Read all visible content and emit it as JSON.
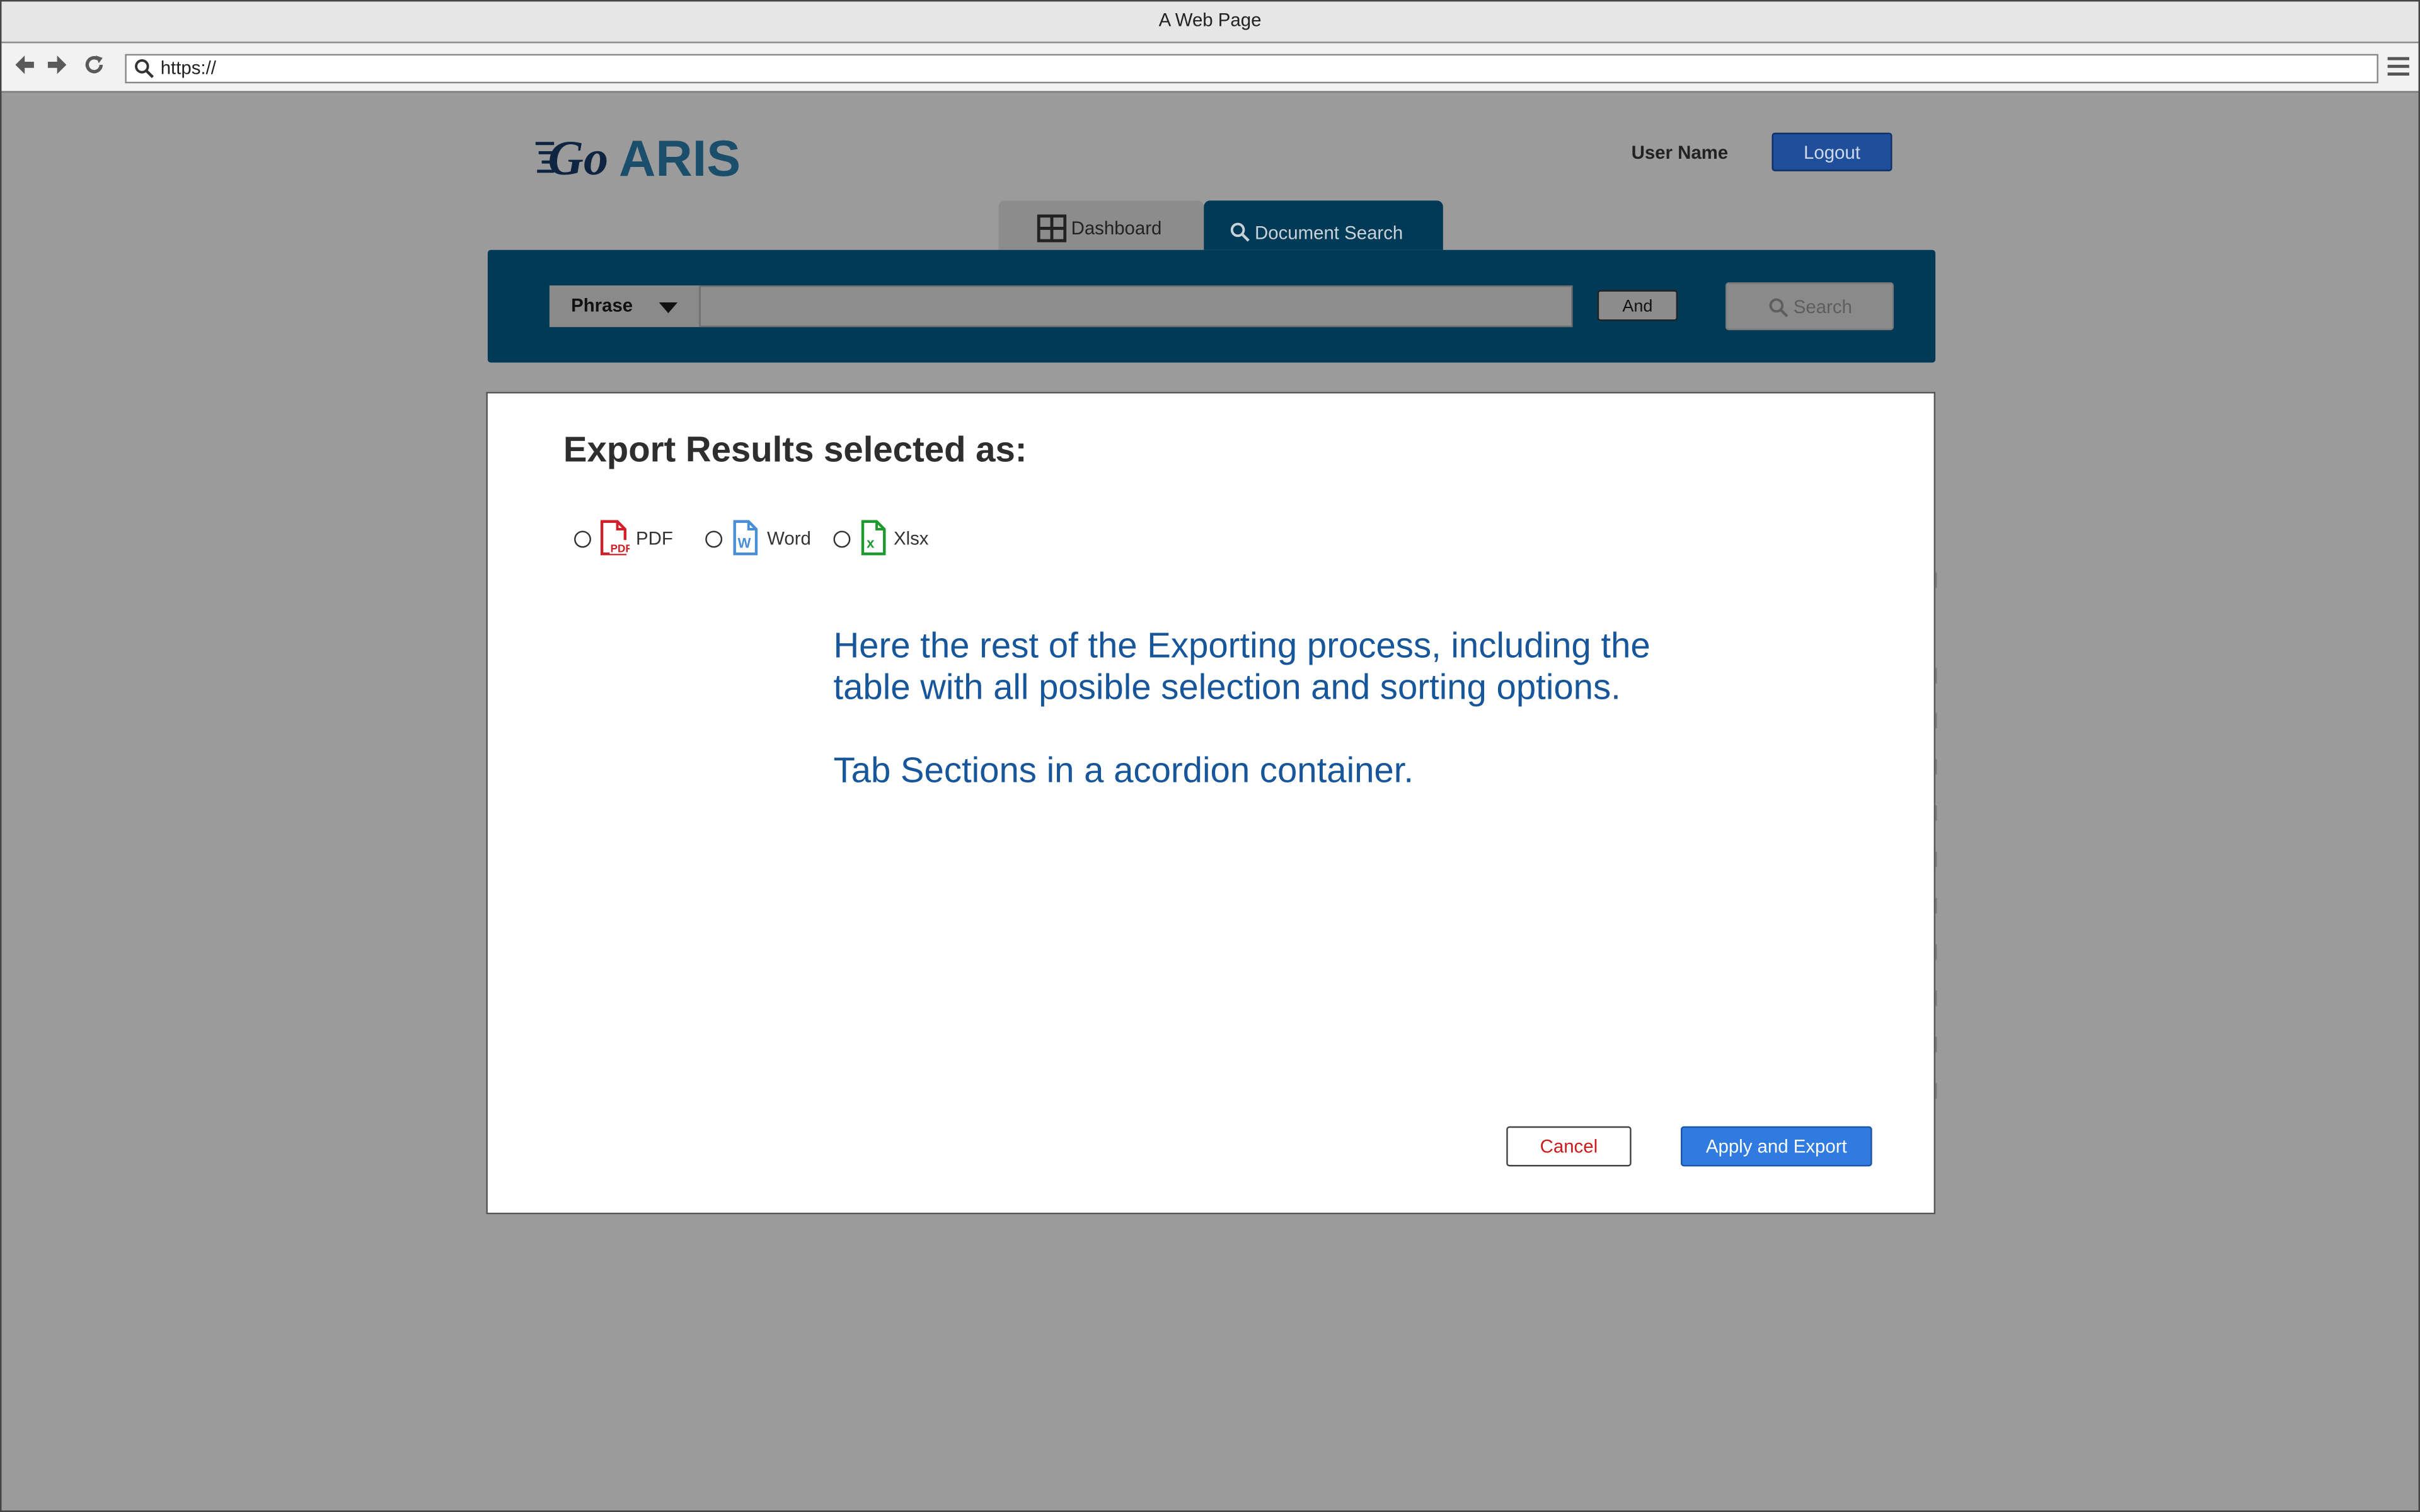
{
  "browser": {
    "window_title": "A Web Page",
    "url": "https://"
  },
  "header": {
    "logo_text": "GoARIS",
    "user_name": "User Name",
    "logout_label": "Logout"
  },
  "tabs": [
    {
      "label": "Dashboard",
      "icon": "grid-icon",
      "active": false
    },
    {
      "label": "Document Search",
      "icon": "search-icon",
      "active": true
    }
  ],
  "search": {
    "mode_selected": "Phrase",
    "query_value": "",
    "operator_label": "And",
    "button_label": "Search"
  },
  "modal": {
    "title": "Export Results selected as:",
    "formats": [
      {
        "label": "PDF",
        "icon": "pdf-file-icon",
        "color": "#d0202a",
        "selected": false
      },
      {
        "label": "Word",
        "icon": "word-file-icon",
        "color": "#4a8fd6",
        "selected": false
      },
      {
        "label": "Xlsx",
        "icon": "excel-file-icon",
        "color": "#1e9a2e",
        "selected": false
      }
    ],
    "body_paragraph_1": "Here the rest of the Exporting process, including the table with all posible selection and sorting options.",
    "body_paragraph_2": "Tab Sections in a acordion container.",
    "cancel_label": "Cancel",
    "apply_label": "Apply and Export"
  },
  "colors": {
    "overlay": "#9b9b9b",
    "nav_dark": "#003a57",
    "accent_blue": "#2f7be0",
    "logout_blue": "#1f4f9a",
    "body_text_blue": "#17569a",
    "cancel_red": "#cc1a1a"
  }
}
